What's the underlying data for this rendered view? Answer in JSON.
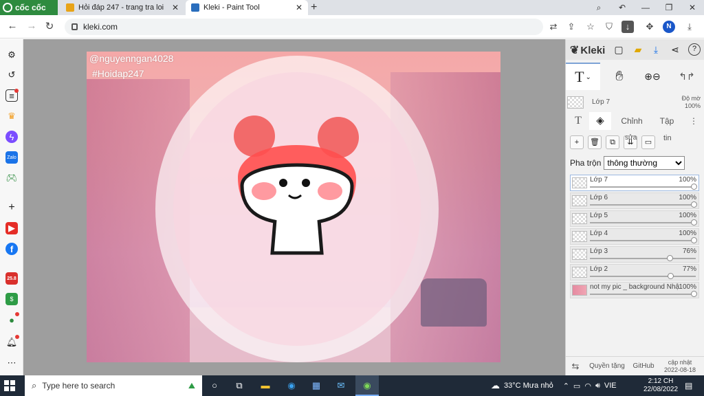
{
  "browser": {
    "brand": "cốc cốc",
    "tabs": [
      {
        "title": "Hỏi đáp 247 - trang tra loi",
        "favicon_color": "#e8a317"
      },
      {
        "title": "Kleki - Paint Tool",
        "favicon_color": "#2a6ebd"
      }
    ],
    "new_tab": "+",
    "url": "kleki.com",
    "profile_initial": "N"
  },
  "sidebar": {
    "icons": [
      "gear-icon",
      "history-icon",
      "list-icon",
      "crown-icon",
      "messenger-icon",
      "zalo-icon",
      "game-icon",
      "add-icon",
      "youtube-icon",
      "facebook-icon",
      "calendar-icon",
      "coupon-icon",
      "chat-icon",
      "bell-icon",
      "more-icon"
    ],
    "badge_label": "25.8"
  },
  "canvas": {
    "watermark_user": "@nguyenngan4028",
    "watermark_tag": "#Hoidap247"
  },
  "kleki": {
    "logo": "Kleki",
    "current_layer": "Lớp 7",
    "opacity_label": "Độ mờ",
    "opacity_value": "100%",
    "tabs": {
      "chinh": "Chỉnh",
      "tap": "Tập",
      "sua": "sửa",
      "tin": "tin"
    },
    "blend_label": "Pha trộn",
    "blend_value": "thông thường",
    "layers": [
      {
        "name": "Lớp 7",
        "opacity": "100%",
        "level": 1.0
      },
      {
        "name": "Lớp 6",
        "opacity": "100%",
        "level": 1.0
      },
      {
        "name": "Lớp 5",
        "opacity": "100%",
        "level": 1.0
      },
      {
        "name": "Lớp 4",
        "opacity": "100%",
        "level": 1.0
      },
      {
        "name": "Lớp 3",
        "opacity": "76%",
        "level": 0.76
      },
      {
        "name": "Lớp 2",
        "opacity": "77%",
        "level": 0.77
      },
      {
        "name": "not my pic _ background Nhậ",
        "opacity": "100%",
        "level": 1.0
      }
    ],
    "footer": {
      "quyen": "Quyền tặng",
      "github": "GitHub",
      "update_label": "cập nhật",
      "update_date": "2022-08-18"
    }
  },
  "taskbar": {
    "search_placeholder": "Type here to search",
    "weather": "33°C Mưa nhỏ",
    "lang": "VIE",
    "time": "2:12 CH",
    "date": "22/08/2022"
  }
}
